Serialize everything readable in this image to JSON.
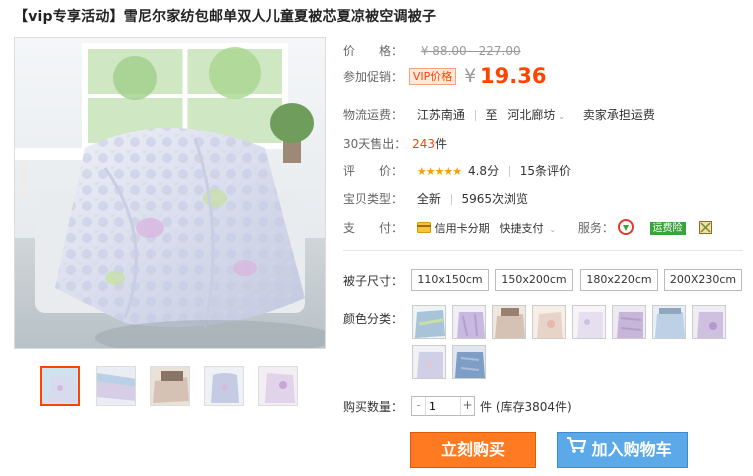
{
  "title": "【vip专享活动】雪尼尔家纺包邮单双人儿童夏被芯夏凉被空调被子",
  "price": {
    "label": "价　　格：",
    "original": "¥ 88.00 - 227.00"
  },
  "promo": {
    "label": "参加促销：",
    "badge": "VIP价格",
    "currency": "¥",
    "price": "19.36"
  },
  "shipping": {
    "label": "物流运费：",
    "from": "江苏南通",
    "to_prefix": "至",
    "to": "河北廊坊",
    "fee": "卖家承担运费"
  },
  "sales": {
    "label": "30天售出：",
    "count": "243",
    "unit": "件"
  },
  "rating": {
    "label": "评　　价：",
    "stars": "★★★★★",
    "score": "4.8分",
    "reviews": "15条评价"
  },
  "item_type": {
    "label": "宝贝类型：",
    "condition": "全新",
    "views": "5965次浏览"
  },
  "payment": {
    "label": "支　　付：",
    "credit": "信用卡分期",
    "quickpay": "快捷支付",
    "service_label": "服务：",
    "freight_insurance": "运费险"
  },
  "size": {
    "label": "被子尺寸：",
    "options": [
      "110x150cm",
      "150x200cm",
      "180x220cm",
      "200X230cm"
    ]
  },
  "color": {
    "label": "颜色分类：",
    "swatch_colors": [
      "#a9c4d8",
      "#c9b8e0",
      "#d6c2b4",
      "#e8d3c8",
      "#e6dff0",
      "#c8b6d8",
      "#bcd0e6",
      "#d0c0e0",
      "#cfcfe6",
      "#7f9ec6"
    ]
  },
  "quantity": {
    "label": "购买数量：",
    "value": "1",
    "minus": "-",
    "plus": "+",
    "stock": "件 (库存3804件)"
  },
  "buttons": {
    "buy_now": "立刻购买",
    "add_to_cart": "加入购物车"
  },
  "colors": {
    "accent": "#ff4400",
    "buy_button": "#ff7a21",
    "cart_button": "#5ba9e8",
    "star": "#f5a000"
  }
}
